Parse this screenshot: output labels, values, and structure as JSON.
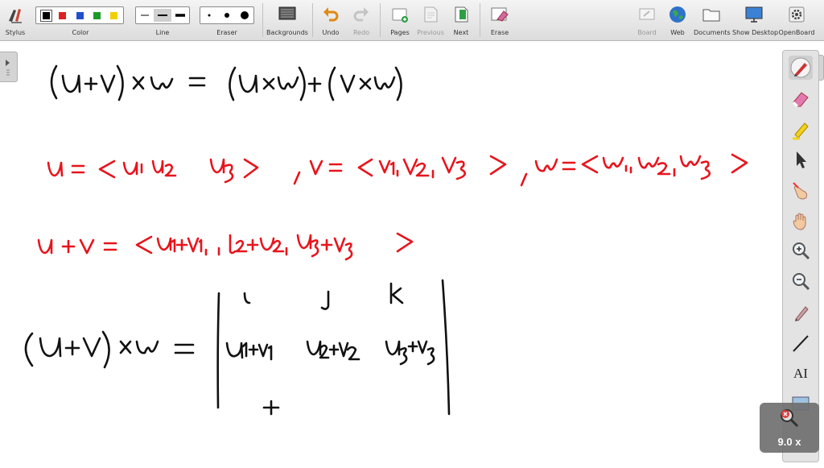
{
  "toolbar": {
    "tools": {
      "stylus": "Stylus",
      "color": "Color",
      "line": "Line",
      "eraser": "Eraser",
      "backgrounds": "Backgrounds",
      "undo": "Undo",
      "redo": "Redo",
      "pages": "Pages",
      "previous": "Previous",
      "next": "Next",
      "erase": "Erase",
      "board": "Board",
      "web": "Web",
      "documents": "Documents",
      "show_desktop": "Show Desktop",
      "openboard": "OpenBoard"
    },
    "colors": [
      "#000000",
      "#e02020",
      "#1f4fd0",
      "#1e9a2a",
      "#f0d000"
    ],
    "selected_color": "#000000"
  },
  "palette": {
    "tools": [
      "pen-icon",
      "eraser-icon",
      "highlighter-icon",
      "pointer-icon",
      "laser-hand-icon",
      "hand-icon",
      "zoom-in-icon",
      "zoom-out-icon",
      "capture-pen-icon",
      "line-icon",
      "text-icon",
      "capture-icon"
    ],
    "text_tool_label": "AI"
  },
  "zoom": {
    "value": "9.0 x"
  },
  "ink": {
    "black": "#111111",
    "red": "#e8141c"
  }
}
